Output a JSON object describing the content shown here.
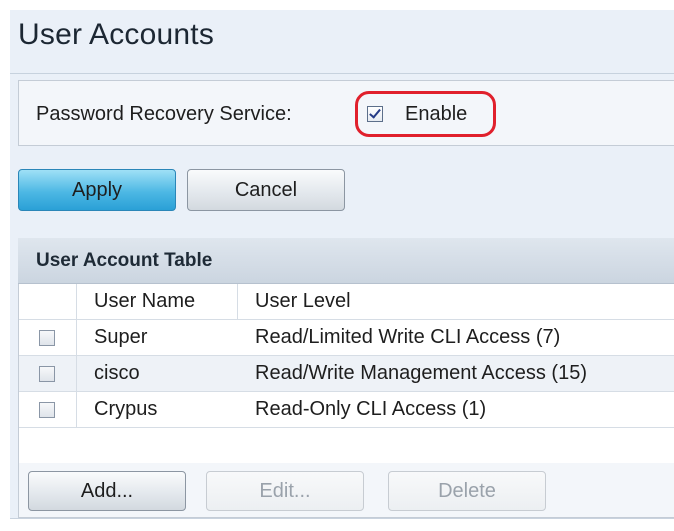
{
  "page": {
    "title": "User Accounts"
  },
  "password_recovery": {
    "label": "Password Recovery Service:",
    "enable_label": "Enable",
    "enabled": true
  },
  "actions": {
    "apply_label": "Apply",
    "cancel_label": "Cancel"
  },
  "table": {
    "caption": "User Account Table",
    "columns": [
      "User Name",
      "User Level"
    ],
    "rows": [
      {
        "user_name": "Super",
        "user_level": "Read/Limited Write CLI Access (7)",
        "selected": false
      },
      {
        "user_name": "cisco",
        "user_level": "Read/Write Management Access (15)",
        "selected": false
      },
      {
        "user_name": "Crypus",
        "user_level": "Read-Only CLI Access (1)",
        "selected": false
      }
    ],
    "buttons": {
      "add_label": "Add...",
      "edit_label": "Edit...",
      "delete_label": "Delete"
    }
  },
  "colors": {
    "highlight": "#e0202c",
    "apply_button": "#4db8e4",
    "panel_background": "#eaf0f8"
  }
}
